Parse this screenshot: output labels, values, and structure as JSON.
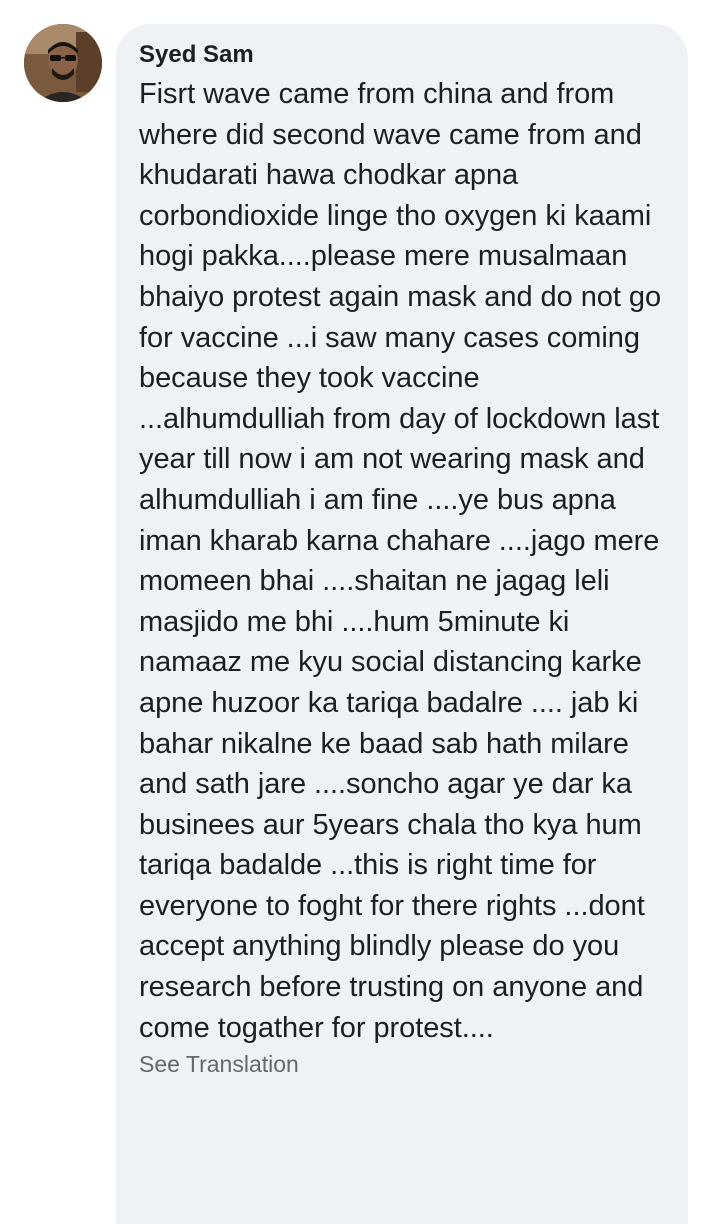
{
  "comment": {
    "author": "Syed Sam",
    "text": "Fisrt wave came from china and from where did second wave came from and khudarati hawa chodkar apna corbondioxide linge tho oxygen ki kaami hogi pakka....please mere musalmaan bhaiyo protest again mask and do not go for vaccine ...i saw many cases coming because they took vaccine ...alhumdulliah from day of lockdown last year till now i am not wearing mask and alhumdulliah i am fine ....ye bus apna iman kharab karna chahare ....jago mere momeen bhai ....shaitan ne jagag leli masjido me bhi ....hum 5minute ki namaaz me kyu social distancing karke apne huzoor ka tariqa badalre .... jab ki bahar nikalne ke baad sab hath milare and sath jare ....soncho agar ye dar ka businees aur 5years chala tho kya hum tariqa badalde ...this is right time for everyone to foght for there rights ...dont accept anything blindly please do you research before trusting on anyone and come togather for protest....",
    "see_translation_label": "See Translation"
  },
  "colors": {
    "bubble_background": "#f0f1f5",
    "text_primary": "#1c1e21",
    "text_secondary": "#65676b"
  },
  "icons": {
    "avatar": "user-avatar-photo"
  }
}
